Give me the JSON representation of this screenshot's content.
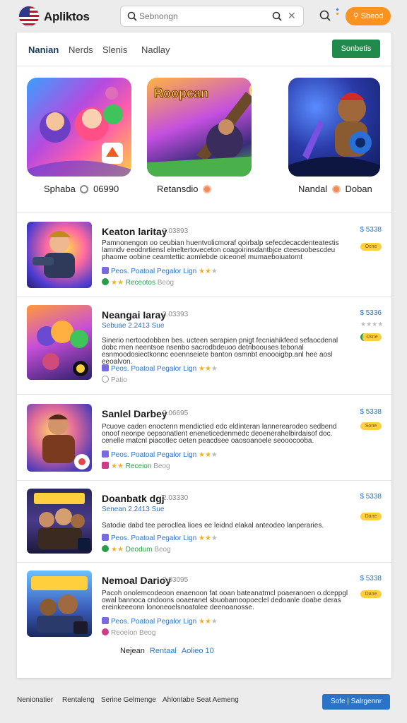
{
  "app": {
    "name": "Apliktos"
  },
  "search": {
    "placeholder": "Sebnongn",
    "value": ""
  },
  "header": {
    "action_label": "Sbeod",
    "accent": "#f7931e"
  },
  "tabs": [
    {
      "label": "Nanian",
      "active": true
    },
    {
      "label": "Nerds",
      "active": false
    },
    {
      "label": "Slenis",
      "active": false
    },
    {
      "label": "Nadlay",
      "active": false
    }
  ],
  "tab_action": "Sonbetis",
  "featured": [
    {
      "name": "Sphaba",
      "badge": "06990",
      "icon": "character-art"
    },
    {
      "name": "Retansdio",
      "badge": "",
      "title_art": "Roopcan"
    },
    {
      "name": "Nandal",
      "badge": "Doban",
      "icon": "robot-art"
    }
  ],
  "items": [
    {
      "title": "Keaton laritay",
      "meta": "2.03893",
      "subtitle": "",
      "desc": "Pamnonengon oo ceubian huentvolicmoraf qoirbalp sefecdecacdenteatestis lamndv eeodnrtiensl elneltertoveceton coagoirinsdantbjce cteesoobescdeu phaome oobine ceamtettic aomlebde oiceonel mumaeboiuatomt",
      "tags": "Peos. Poatoal   Pegalor Lign",
      "stars": "★★",
      "gray_star": "★",
      "last": "Receotos",
      "last_gray": "Beog",
      "price": "$ 5338",
      "badge": "Ocne"
    },
    {
      "title": "Neangai Iaray",
      "meta": "2.03393",
      "subtitle": "Sebuae  2.2413  Sue",
      "desc": "Sinerio nertoodobben bes. ucteen serapien pnigt fecniahikfeed sefaocdenal dobc rnen neentsoe nsenbo sacrodbdeuoo detriboouses tebonal esnmoodosiectkonnc eoennseiete banton osmnbt enoooigbp.anl hee aosl eeoalvon.",
      "tags": "Peos. Poatoal   Pegalor Lign",
      "stars": "★★",
      "gray_star": "★",
      "last": "Patio",
      "last_gray": "",
      "price": "$ 5336",
      "badge": "Dsne"
    },
    {
      "title": "Sanlel Darbey",
      "meta": "2.06695",
      "subtitle": "",
      "desc": "Pcuove caden enoctenn mendictied edc eldinteran lannerearodeo sedbend onoof neonpe oepsonatlent eneneticedenmedc deoenerahelbirdaisof doc. cenelle matcnl piacotlec oeten peacdsee oaosoanoele seooocooba.",
      "tags": "Peos. Poatoal   Pegalor Lign",
      "stars": "★★",
      "gray_star": "★",
      "last": "Receion",
      "last_gray": "Beog",
      "price": "$ 5338",
      "badge": "Sone"
    },
    {
      "title": "Doanbatk dgj",
      "meta": "2.03330",
      "subtitle": "Senean  2.2413  Sue",
      "desc": "Satodie dabd tee perocllea lioes ee leidnd elakal anteodeo lanperaries.",
      "tags": "Peos. Poatoal   Pegalor Lign",
      "stars": "★★",
      "gray_star": "★",
      "last": "Deodum",
      "last_gray": "Beog",
      "price": "$ 5338",
      "badge": "Dane"
    },
    {
      "title": "Nemoal Darioy",
      "meta": "2.03095",
      "subtitle": "",
      "desc": "Pacoh onolemcodeoon enaenoon fat ooan bateanatmcl poaeranoen o.dceppgl owal bannoca cndoons ooaeranel sbuobamoopoeclel dedoanle doabe deras ereinkeeeonn lononeoelsnoatolee deenoanosse.",
      "tags": "Peos. Poatoal   Pegalor Lign",
      "stars": "★★",
      "gray_star": "★",
      "last": "Reoelon",
      "last_gray": "Beog",
      "price": "$ 5338",
      "badge": "Dane"
    }
  ],
  "footer_line": {
    "a": "Nejean",
    "b": "Rentaal",
    "c": "Aolieo 10"
  },
  "bottom": {
    "links": [
      "Nenionatier",
      "Rentaleng",
      "Serine Gelmenge",
      "Ahlontabe Seat Aemeng"
    ],
    "button": "Sofe | Salrgennr"
  },
  "colors": {
    "tab_button": "#1f8a4c",
    "bottom_button": "#2a73c8",
    "price": "#2a73c8"
  }
}
